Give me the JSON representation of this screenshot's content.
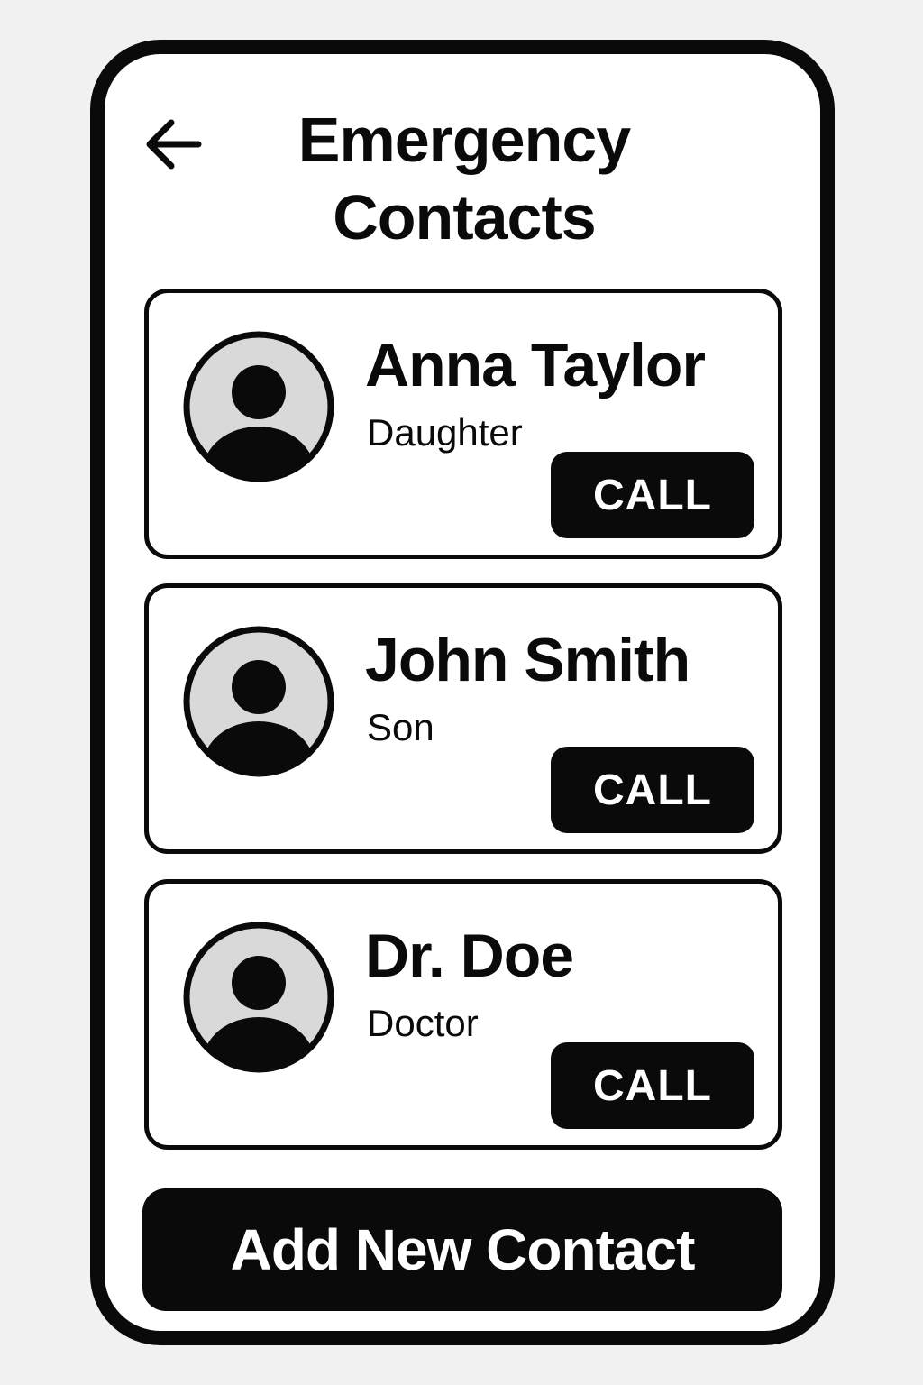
{
  "header": {
    "title": "Emergency Contacts",
    "back_icon": "arrow-left-icon"
  },
  "contacts": [
    {
      "name": "Anna Taylor",
      "relation": "Daughter",
      "call_label": "CALL",
      "avatar_icon": "user-avatar-icon"
    },
    {
      "name": "John Smith",
      "relation": "Son",
      "call_label": "CALL",
      "avatar_icon": "user-avatar-icon"
    },
    {
      "name": "Dr. Doe",
      "relation": "Doctor",
      "call_label": "CALL",
      "avatar_icon": "user-avatar-icon"
    }
  ],
  "footer": {
    "add_label": "Add New Contact"
  },
  "colors": {
    "primary": "#0a0a0a",
    "avatar_fill": "#d9d9d9",
    "background": "#ffffff"
  }
}
